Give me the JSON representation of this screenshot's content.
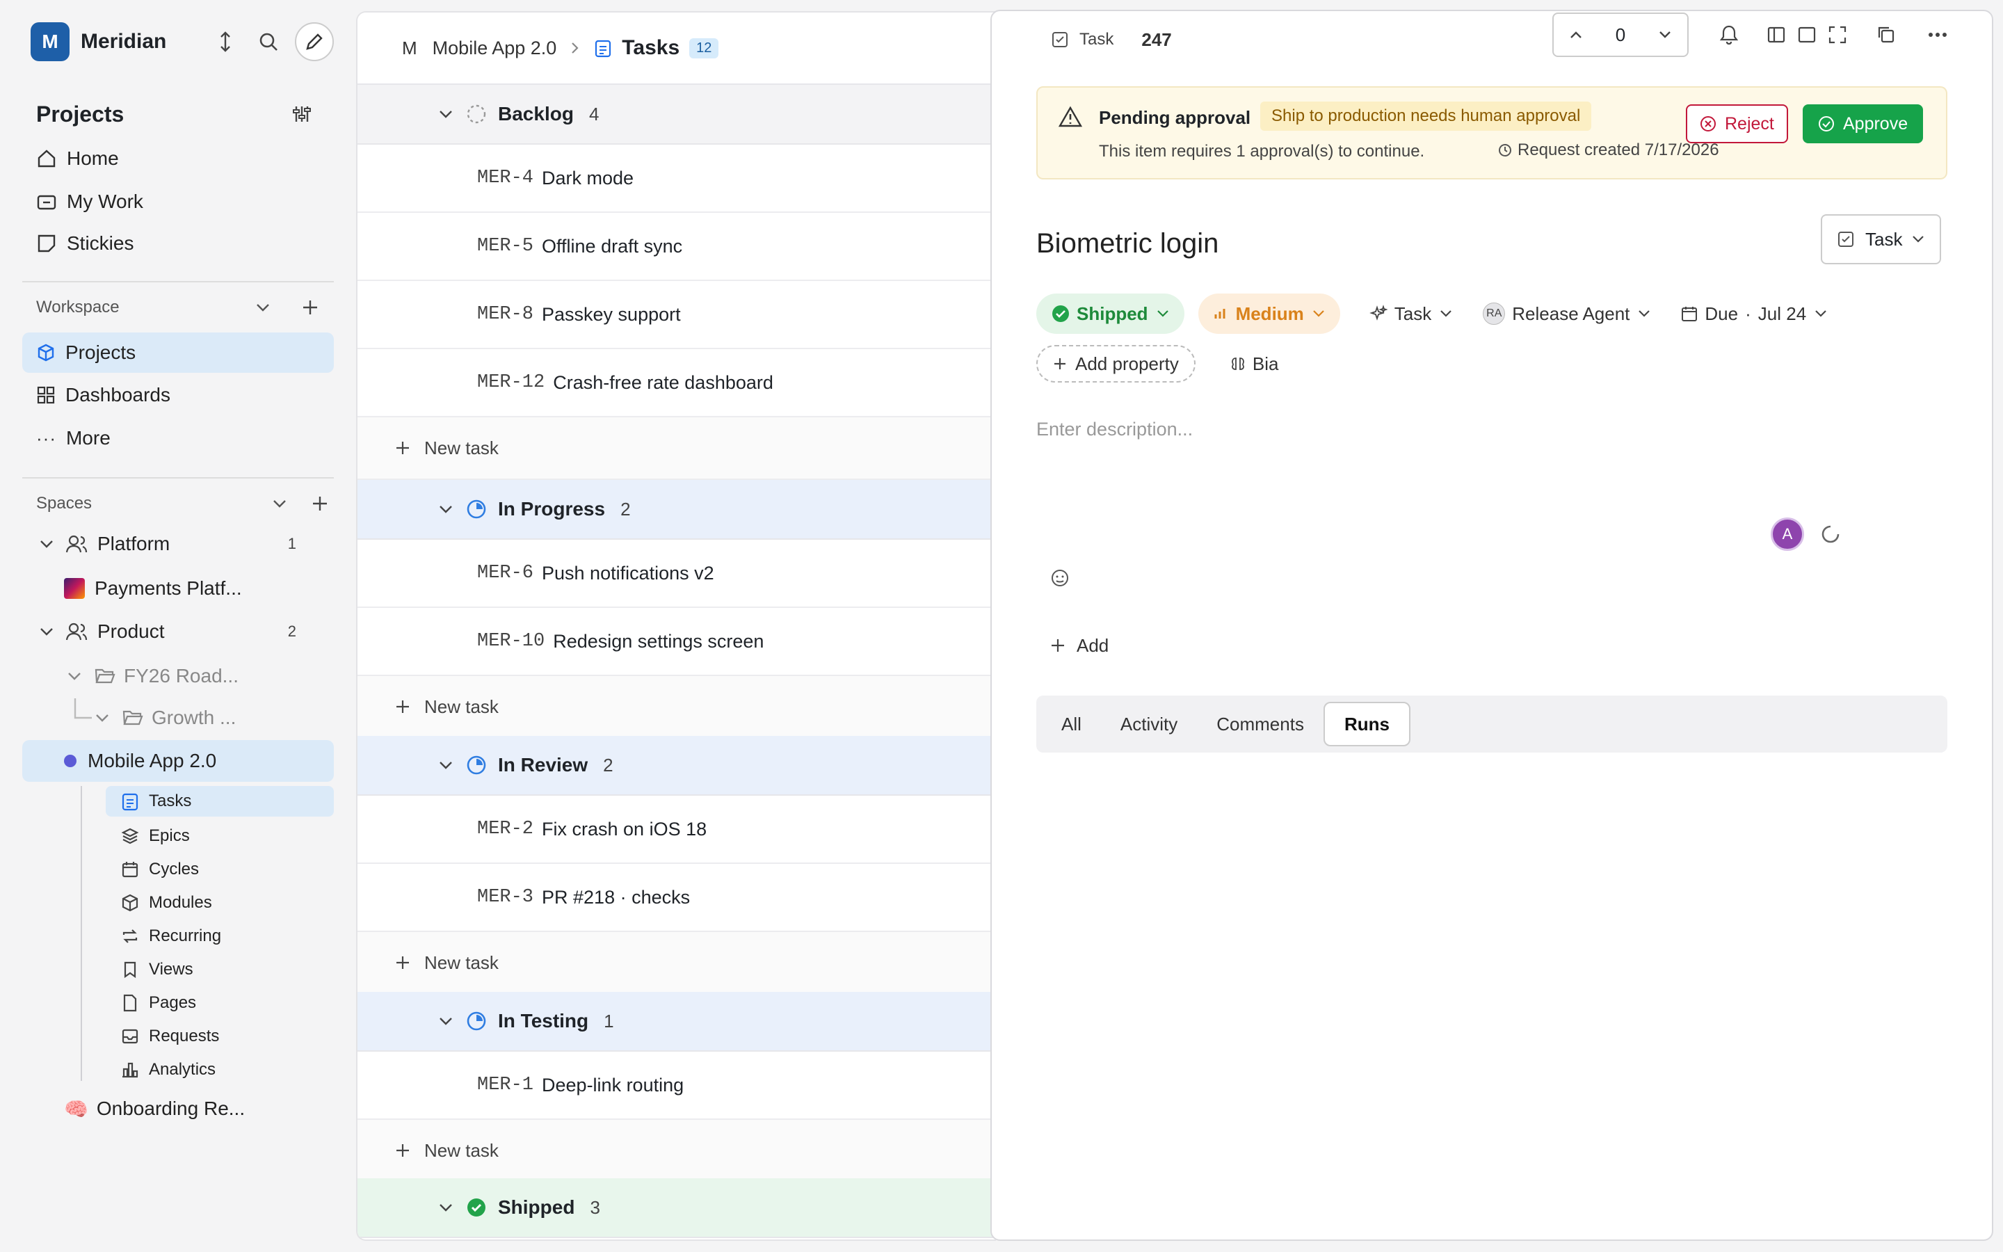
{
  "workspace": {
    "initial": "M",
    "name": "Meridian"
  },
  "sidebar": {
    "projects_title": "Projects",
    "nav": [
      {
        "label": "Home"
      },
      {
        "label": "My Work"
      },
      {
        "label": "Stickies"
      }
    ],
    "workspace_label": "Workspace",
    "workspace_items": [
      {
        "label": "Projects"
      },
      {
        "label": "Dashboards"
      },
      {
        "label": "More"
      }
    ],
    "spaces_label": "Spaces",
    "spaces": [
      {
        "label": "Platform",
        "count": "1"
      },
      {
        "label": "Payments Platf..."
      },
      {
        "label": "Product",
        "count": "2"
      },
      {
        "label": "FY26 Road..."
      },
      {
        "label": "Growth ..."
      },
      {
        "label": "Mobile App 2.0"
      }
    ],
    "project_items": [
      {
        "label": "Tasks"
      },
      {
        "label": "Epics"
      },
      {
        "label": "Cycles"
      },
      {
        "label": "Modules"
      },
      {
        "label": "Recurring"
      },
      {
        "label": "Views"
      },
      {
        "label": "Pages"
      },
      {
        "label": "Requests"
      },
      {
        "label": "Analytics"
      }
    ],
    "onboarding": "Onboarding Re..."
  },
  "header": {
    "prefix": "M",
    "project": "Mobile App 2.0",
    "page": "Tasks",
    "count": "12"
  },
  "groups": [
    {
      "name": "Backlog",
      "count": "4",
      "tasks": [
        {
          "id": "MER-4",
          "title": "Dark mode"
        },
        {
          "id": "MER-5",
          "title": "Offline draft sync"
        },
        {
          "id": "MER-8",
          "title": "Passkey support"
        },
        {
          "id": "MER-12",
          "title": "Crash-free rate dashboard"
        }
      ]
    },
    {
      "name": "In Progress",
      "count": "2",
      "tasks": [
        {
          "id": "MER-6",
          "title": "Push notifications v2"
        },
        {
          "id": "MER-10",
          "title": "Redesign settings screen"
        }
      ]
    },
    {
      "name": "In Review",
      "count": "2",
      "tasks": [
        {
          "id": "MER-2",
          "title": "Fix crash on iOS 18"
        },
        {
          "id": "MER-3",
          "title": "PR #218 · checks",
          "mono_part": "PR #218"
        }
      ]
    },
    {
      "name": "In Testing",
      "count": "1",
      "tasks": [
        {
          "id": "MER-1",
          "title": "Deep-link routing"
        }
      ]
    },
    {
      "name": "Shipped",
      "count": "3",
      "tasks": []
    }
  ],
  "new_task_label": "New task",
  "panel": {
    "type_label": "Task",
    "number": "247",
    "stepper_value": "0",
    "approval": {
      "title": "Pending approval",
      "tag": "Ship to production needs human approval",
      "message": "This item requires 1 approval(s) to continue.",
      "created": "Request created 7/17/2026",
      "reject": "Reject",
      "approve": "Approve"
    },
    "title": "Biometric login",
    "type_button": "Task",
    "properties": {
      "status": "Shipped",
      "priority": "Medium",
      "type": "Task",
      "assignee_initials": "RA",
      "assignee": "Release Agent",
      "due_label": "Due",
      "due": "Jul 24",
      "add_property": "Add property",
      "extra": "Bia"
    },
    "description_placeholder": "Enter description...",
    "avatar": "A",
    "add_label": "Add",
    "tabs": [
      {
        "label": "All"
      },
      {
        "label": "Activity"
      },
      {
        "label": "Comments"
      },
      {
        "label": "Runs"
      }
    ],
    "active_tab": "Runs"
  },
  "colors": {
    "accent": "#1f6feb",
    "approve": "#16a34a",
    "reject": "#c2183a",
    "warning_bg": "#fef9e7"
  }
}
